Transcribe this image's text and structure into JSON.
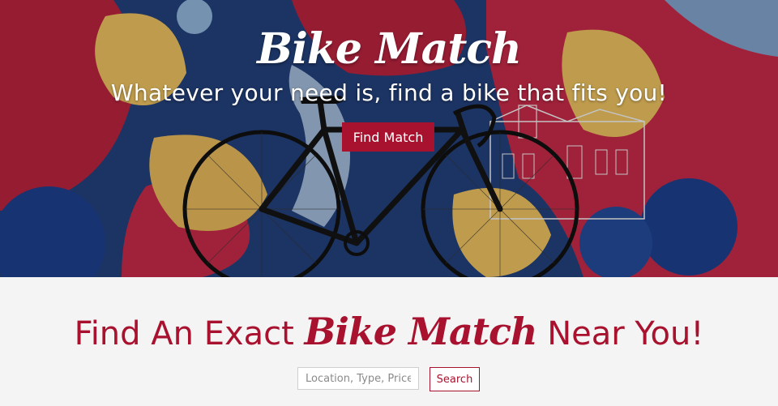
{
  "hero": {
    "title": "Bike Match",
    "subtitle": "Whatever your need is, find a bike that fits you!",
    "cta_label": "Find Match"
  },
  "search_section": {
    "headline_pre": "Find An Exact ",
    "headline_brand": "Bike Match",
    "headline_post": " Near You!",
    "input_placeholder": "Location, Type, Price..",
    "search_label": "Search"
  },
  "colors": {
    "accent": "#a8122f",
    "section_bg": "#f4f4f4"
  }
}
